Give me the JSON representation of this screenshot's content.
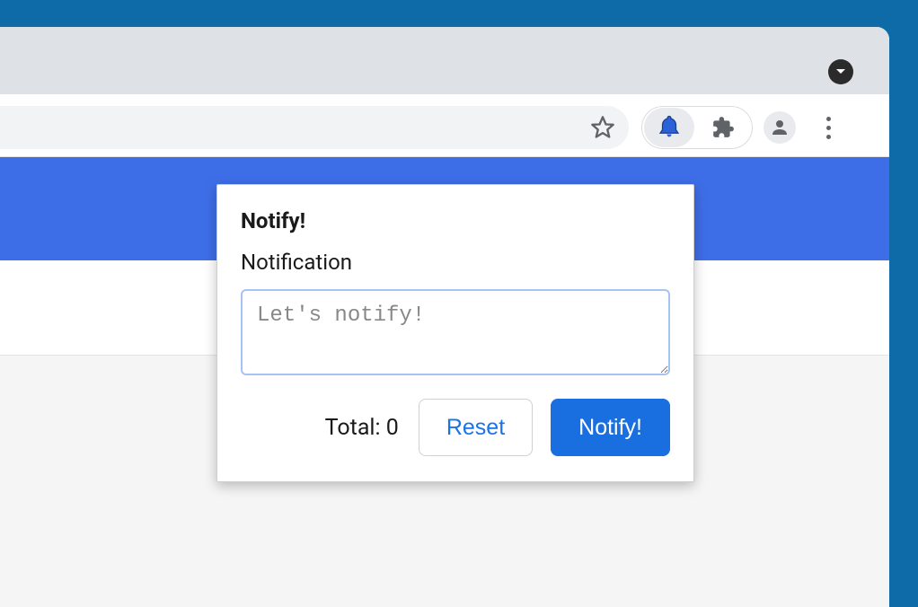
{
  "popup": {
    "title": "Notify!",
    "label": "Notification",
    "placeholder": "Let's notify!",
    "value": "",
    "total_label": "Total:",
    "total_value": "0",
    "reset_label": "Reset",
    "notify_label": "Notify!"
  },
  "colors": {
    "blue_header": "#3e6ee7",
    "primary_button": "#1a6fe0",
    "link_blue": "#1a73e8",
    "focus_border": "#a5c4f1"
  }
}
